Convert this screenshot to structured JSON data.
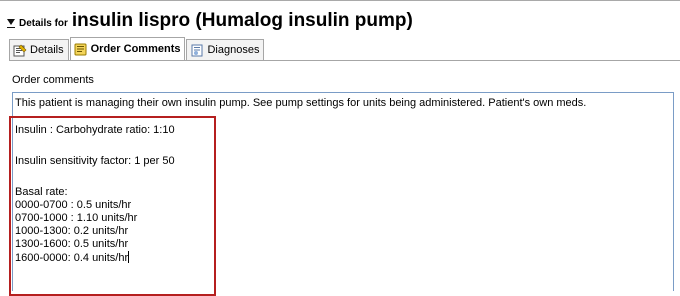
{
  "header": {
    "prefix": "Details for",
    "title": "insulin lispro (Humalog insulin pump)"
  },
  "tabs": [
    {
      "label": "Details",
      "active": false,
      "icon": "details-icon"
    },
    {
      "label": "Order Comments",
      "active": true,
      "icon": "order-comments-icon"
    },
    {
      "label": "Diagnoses",
      "active": false,
      "icon": "diagnoses-icon"
    }
  ],
  "comments": {
    "section_label": "Order comments",
    "text_line": "This patient is managing their own insulin pump. See pump settings for units being administered. Patient's own meds.",
    "ratio": "Insulin : Carbohydrate ratio: 1:10",
    "sensitivity": "Insulin sensitivity factor: 1 per 50",
    "basal_label": "Basal rate:",
    "basal_rates": [
      "0000-0700 : 0.5 units/hr",
      "0700-1000 : 1.10 units/hr",
      "1000-1300: 0.2 units/hr",
      "1300-1600: 0.5 units/hr",
      "1600-0000: 0.4 units/hr"
    ]
  },
  "colors": {
    "highlight_box": "#b51f1f",
    "field_border": "#7a9cc6"
  }
}
